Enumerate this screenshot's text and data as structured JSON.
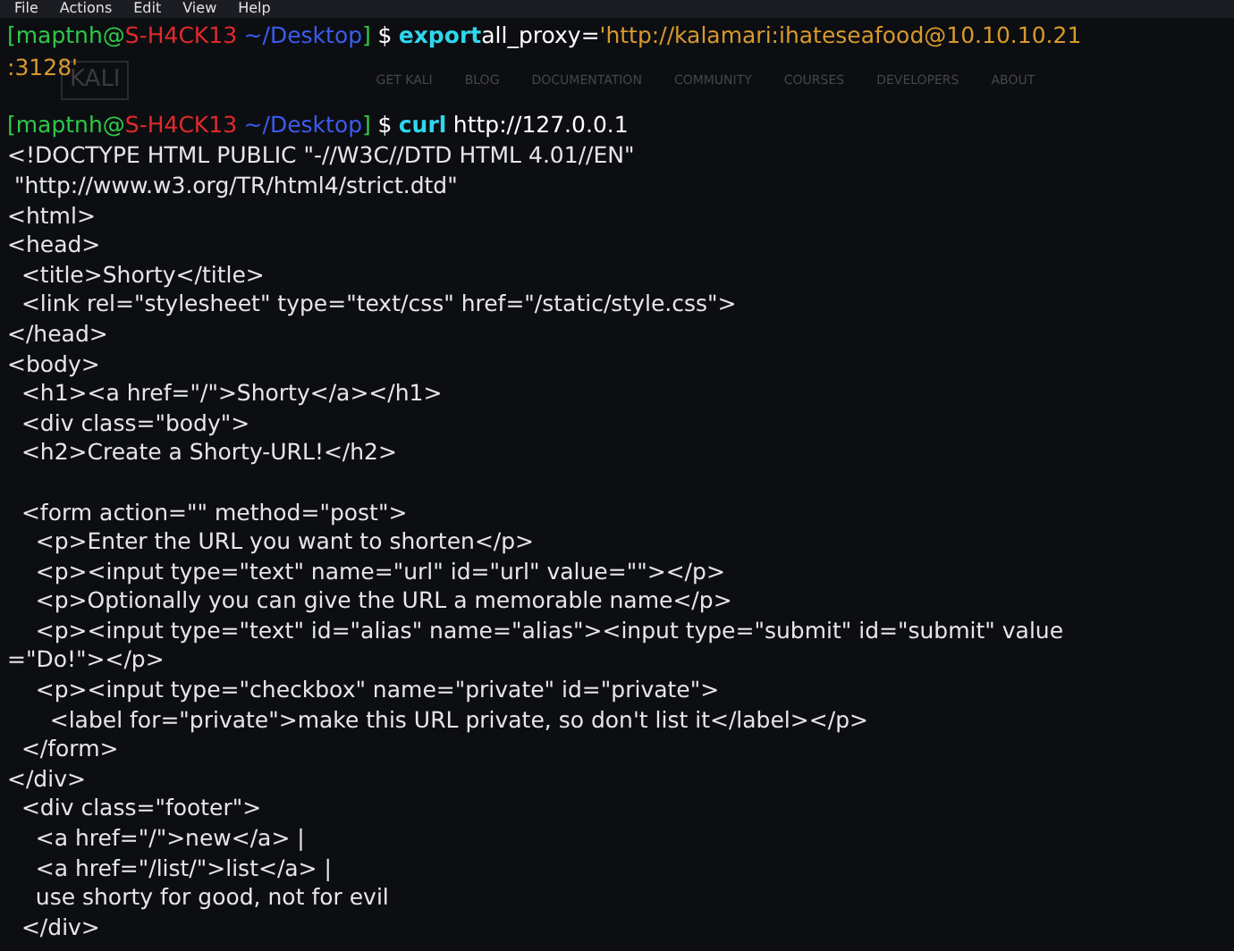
{
  "menu_bar": [
    "File",
    "Actions",
    "Edit",
    "View",
    "Help"
  ],
  "background_site": {
    "logo": "KALI",
    "nav": [
      "GET KALI",
      "BLOG",
      "DOCUMENTATION",
      "COMMUNITY",
      "COURSES",
      "DEVELOPERS",
      "ABOUT"
    ]
  },
  "terminal_lines": [
    {
      "kind": "prompt",
      "prompt": [
        {
          "text": "[maptnh@",
          "color": "#2ec84a"
        },
        {
          "text": "S-H4CK13",
          "color": "#e02b2b"
        },
        {
          "text": "~/Desktop",
          "color": "#3b5cf0"
        },
        {
          "text": "]",
          "color": "#2ec84a"
        }
      ],
      "symbol": "$",
      "command": "export",
      "args": [
        {
          "kind": "plain",
          "text": "all_proxy="
        },
        {
          "kind": "string",
          "text": "'http://kalamari:ihateseafood@10.10.10.21"
        }
      ]
    },
    {
      "kind": "string",
      "text": ":3128'"
    },
    {
      "kind": "blank"
    },
    {
      "kind": "prompt",
      "prompt": [
        {
          "text": "[maptnh@",
          "color": "#2ec84a"
        },
        {
          "text": "S-H4CK13",
          "color": "#e02b2b"
        },
        {
          "text": "~/Desktop",
          "color": "#3b5cf0"
        },
        {
          "text": "]",
          "color": "#2ec84a"
        }
      ],
      "symbol": "$",
      "command": "curl",
      "args": [
        {
          "kind": "plain",
          "text": "http://127.0.0.1",
          "spaced": true
        }
      ]
    },
    {
      "kind": "output",
      "text": "<!DOCTYPE HTML PUBLIC \"-//W3C//DTD HTML 4.01//EN\""
    },
    {
      "kind": "output",
      "text": " \"http://www.w3.org/TR/html4/strict.dtd\""
    },
    {
      "kind": "output",
      "text": "<html>"
    },
    {
      "kind": "output",
      "text": "<head>"
    },
    {
      "kind": "output",
      "text": "  <title>Shorty</title>"
    },
    {
      "kind": "output",
      "text": "  <link rel=\"stylesheet\" type=\"text/css\" href=\"/static/style.css\">"
    },
    {
      "kind": "output",
      "text": "</head>"
    },
    {
      "kind": "output",
      "text": "<body>"
    },
    {
      "kind": "output",
      "text": "  <h1><a href=\"/\">Shorty</a></h1>"
    },
    {
      "kind": "output",
      "text": "  <div class=\"body\">"
    },
    {
      "kind": "output",
      "text": "  <h2>Create a Shorty-URL!</h2>"
    },
    {
      "kind": "blank"
    },
    {
      "kind": "output",
      "text": "  <form action=\"\" method=\"post\">"
    },
    {
      "kind": "output",
      "text": "    <p>Enter the URL you want to shorten</p>"
    },
    {
      "kind": "output",
      "text": "    <p><input type=\"text\" name=\"url\" id=\"url\" value=\"\"></p>"
    },
    {
      "kind": "output",
      "text": "    <p>Optionally you can give the URL a memorable name</p>"
    },
    {
      "kind": "output",
      "text": "    <p><input type=\"text\" id=\"alias\" name=\"alias\"><input type=\"submit\" id=\"submit\" value"
    },
    {
      "kind": "output",
      "text": "=\"Do!\"></p>"
    },
    {
      "kind": "output",
      "text": "    <p><input type=\"checkbox\" name=\"private\" id=\"private\">"
    },
    {
      "kind": "output",
      "text": "      <label for=\"private\">make this URL private, so don't list it</label></p>"
    },
    {
      "kind": "output",
      "text": "  </form>"
    },
    {
      "kind": "output",
      "text": "</div>"
    },
    {
      "kind": "output",
      "text": "  <div class=\"footer\">"
    },
    {
      "kind": "output",
      "text": "    <a href=\"/\">new</a> |"
    },
    {
      "kind": "output",
      "text": "    <a href=\"/list/\">list</a> |"
    },
    {
      "kind": "output",
      "text": "    use shorty for good, not for evil"
    },
    {
      "kind": "output",
      "text": "  </div>"
    }
  ]
}
